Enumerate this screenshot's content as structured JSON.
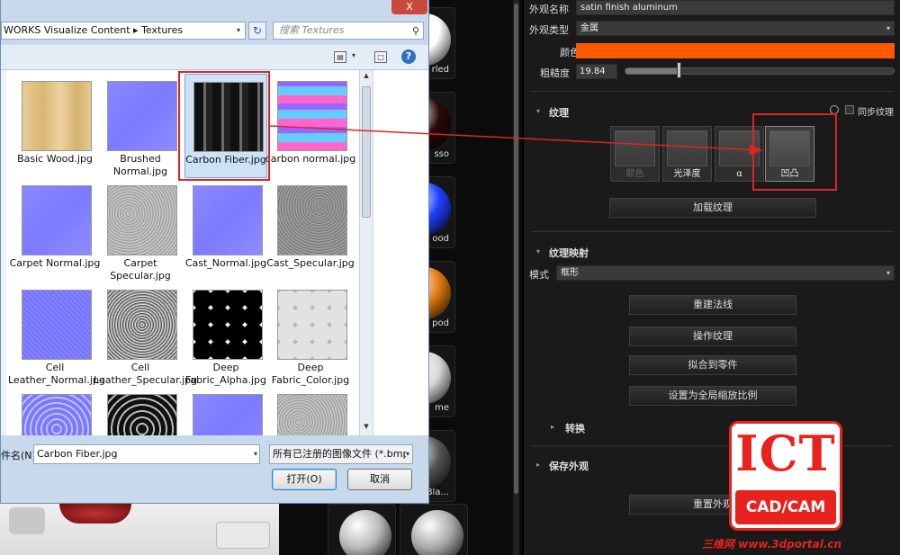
{
  "dialog": {
    "close_glyph": "X",
    "path": "WORKS Visualize Content ▸ Textures",
    "path_dropdown": "▾",
    "refresh_glyph": "↻",
    "search_placeholder": "搜索 Textures",
    "search_glyph": "⚲",
    "view_glyph": "▤",
    "view_dropdown": "▾",
    "pane_glyph": "□",
    "help_glyph": "?",
    "files": [
      {
        "label": "Basic Wood.jpg",
        "thumb": "wood"
      },
      {
        "label": "Brushed Normal.jpg",
        "thumb": "normal"
      },
      {
        "label": "Carbon Fiber.jpg",
        "thumb": "carbon",
        "selected": true
      },
      {
        "label": "carbon normal.jpg",
        "thumb": "carbonnormal"
      },
      {
        "label": "Carpet Normal.jpg",
        "thumb": "normal"
      },
      {
        "label": "Carpet Specular.jpg",
        "thumb": "noise"
      },
      {
        "label": "Cast_Normal.jpg",
        "thumb": "normal"
      },
      {
        "label": "Cast_Specular.jpg",
        "thumb": "noisedark"
      },
      {
        "label": "Cell Leather_Normal.jpg",
        "thumb": "leathernormal"
      },
      {
        "label": "Cell Leather_Specular.jpg",
        "thumb": "leatherspec"
      },
      {
        "label": "Deep Fabric_Alpha.jpg",
        "thumb": "fabricalpha"
      },
      {
        "label": "Deep Fabric_Color.jpg",
        "thumb": "fabriccolor"
      },
      {
        "label": "",
        "thumb": "meshnormal"
      },
      {
        "label": "",
        "thumb": "meshdark"
      },
      {
        "label": "",
        "thumb": "normal"
      },
      {
        "label": "",
        "thumb": "noise"
      }
    ],
    "filename_label": "件名(N):",
    "filename_value": "Carbon Fiber.jpg",
    "filetype_value": "所有已注册的图像文件 (*.bmp",
    "dropdown_glyph": "▾",
    "open_label": "打开(O)",
    "cancel_label": "取消"
  },
  "materials": [
    {
      "caption": "rled",
      "color": "#ffffff"
    },
    {
      "caption": "sso",
      "color": "#2a0a0a"
    },
    {
      "caption": "ood",
      "color": "#1f3fff"
    },
    {
      "caption": "pod",
      "color": "#e07a10"
    },
    {
      "caption": "me",
      "color": "#d8d8d8"
    },
    {
      "caption": "Bla...",
      "color": "#555555"
    },
    {
      "caption": "",
      "color": "#b8b8b8"
    },
    {
      "caption": "",
      "color": "#a8a8a8"
    }
  ],
  "panel": {
    "name_label": "外观名称",
    "name_value": "satin finish aluminum",
    "type_label": "外观类型",
    "type_value": "金属",
    "color_label": "颜色",
    "color_hex": "#ff5a00",
    "roughness_label": "粗糙度",
    "roughness_value": "19.84",
    "roughness_fraction": 0.2,
    "texture_section": "纹理",
    "sync_label": "同步纹理",
    "slots": [
      {
        "label": "颜色",
        "dim": true
      },
      {
        "label": "光泽度",
        "dim": false
      },
      {
        "label": "α",
        "dim": false
      },
      {
        "label": "凹凸",
        "dim": false,
        "selected": true
      }
    ],
    "load_texture": "加载纹理",
    "mapping_section": "纹理映射",
    "mode_label": "模式",
    "mode_value": "框形",
    "rebuild_normals": "重建法线",
    "manipulate_texture": "操作纹理",
    "fit_to_part": "拟合到零件",
    "set_global_scale": "设置为全局缩放比例",
    "transform_section": "转换",
    "save_section": "保存外观",
    "reset_appearance": "重置外观",
    "collapse_glyph": "▾",
    "expand_glyph": "▸"
  },
  "watermark": {
    "logo_big": "ICT",
    "logo_small": "CAD/CAM",
    "site": "三维网 www.3dportal.cn"
  },
  "colors": {
    "annotation": "#e02424"
  }
}
